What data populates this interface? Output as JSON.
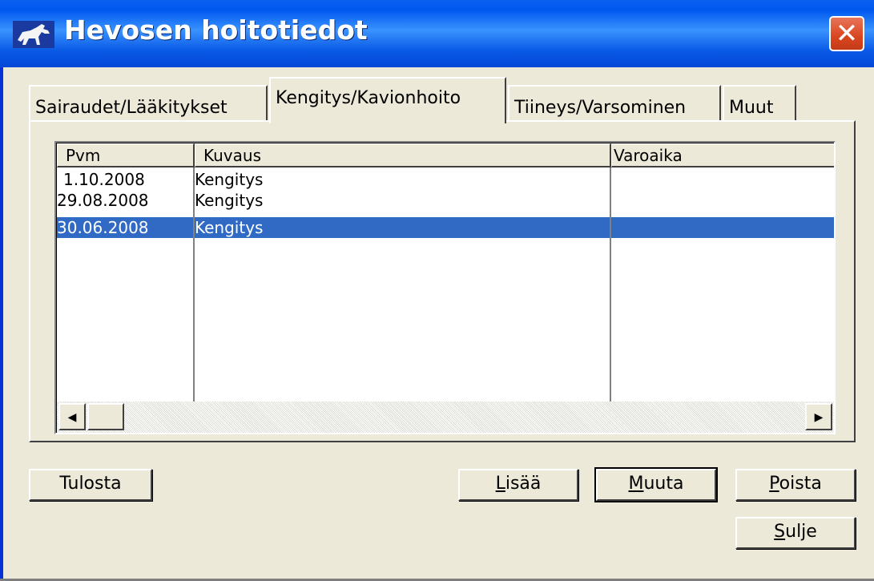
{
  "window": {
    "title": "Hevosen hoitotiedot",
    "close_glyph": "✕",
    "icon": "horse-icon"
  },
  "tabs": [
    {
      "label": "Sairaudet/Lääkitykset",
      "active": false
    },
    {
      "label": "Kengitys/Kavionhoito",
      "active": true
    },
    {
      "label": "Tiineys/Varsominen",
      "active": false
    },
    {
      "label": "Muut",
      "active": false
    }
  ],
  "table": {
    "columns": [
      "Pvm",
      "Kuvaus",
      "Varoaika"
    ],
    "rows": [
      {
        "pvm": "1.10.2008",
        "kuvaus": "Kengitys",
        "varoaika": ""
      },
      {
        "pvm": "29.08.2008",
        "kuvaus": "Kengitys",
        "varoaika": ""
      },
      {
        "pvm": "30.06.2008",
        "kuvaus": "Kengitys",
        "varoaika": "",
        "selected": true
      }
    ]
  },
  "scrollbar": {
    "left_arrow": "◀",
    "right_arrow": "▶"
  },
  "buttons": {
    "tulosta": "Tulosta",
    "lisaa": {
      "first": "L",
      "rest": "isää"
    },
    "muuta": {
      "first": "M",
      "rest": "uuta"
    },
    "poista": {
      "first": "P",
      "rest": "oista"
    },
    "sulje": {
      "first": "S",
      "rest": "ulje"
    }
  },
  "colors": {
    "titlebar": "#0058ee",
    "selection": "#316ac5",
    "face": "#ece9d8",
    "close": "#d9461f"
  }
}
